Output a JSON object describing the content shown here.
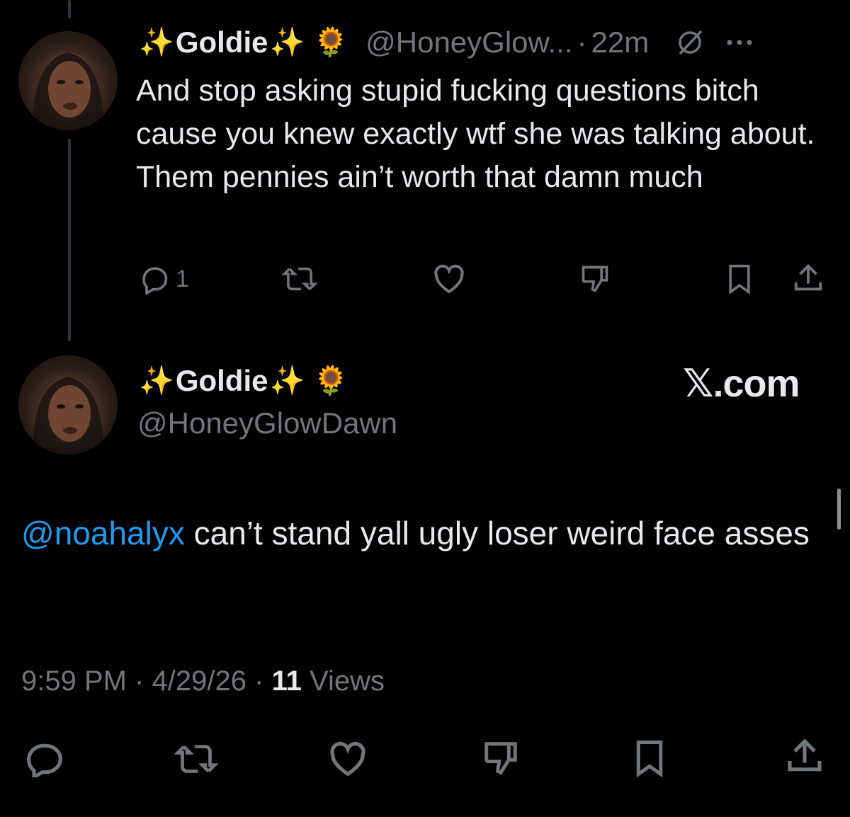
{
  "reply_tweet": {
    "sparkle_left": "✨",
    "display_name": "Goldie",
    "sparkle_right": "✨",
    "emoji": "🌻",
    "handle": "@HoneyGlow...",
    "separator": "·",
    "time": "22m",
    "text": "And stop asking stupid fucking questions bitch cause you knew exactly wtf she was talking about. Them pennies ain’t worth that damn much",
    "reply_count": "1",
    "icons": [
      "reply-icon",
      "retweet-icon",
      "like-icon",
      "dislike-icon",
      "bookmark-icon",
      "share-icon",
      "grok-icon",
      "more-icon"
    ]
  },
  "main_tweet": {
    "sparkle_left": "✨",
    "display_name": "Goldie",
    "sparkle_right": "✨",
    "emoji": "🌻",
    "handle": "@HoneyGlowDawn",
    "brand": "𝕏.com",
    "mention": "@noahalyx",
    "text": " can’t stand yall ugly loser weird face asses",
    "time": "9:59 PM",
    "sep1": "·",
    "date": "4/29/26",
    "sep2": "·",
    "views_count": "11",
    "views_label": "Views",
    "icons": [
      "reply-icon",
      "retweet-icon",
      "like-icon",
      "dislike-icon",
      "bookmark-icon",
      "share-icon"
    ]
  },
  "colors": {
    "background": "#000000",
    "text": "#e7e9ea",
    "secondary": "#71767b",
    "link": "#1d9bf0",
    "thread_line": "#333639"
  }
}
